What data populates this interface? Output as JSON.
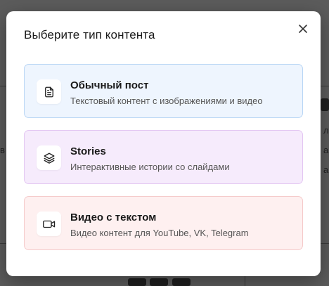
{
  "dialog": {
    "title": "Выберите тип контента",
    "close_icon": "close-icon"
  },
  "options": [
    {
      "title": "Обычный пост",
      "description": "Текстовый контент с изображениями и видео",
      "icon": "document-icon",
      "accent_bg": "#eef5fe",
      "accent_border": "#b9d6f5"
    },
    {
      "title": "Stories",
      "description": "Интерактивные истории со слайдами",
      "icon": "layers-icon",
      "accent_bg": "#f6ebfc",
      "accent_border": "#e3c6f2"
    },
    {
      "title": "Видео с текстом",
      "description": "Видео контент для YouTube, VK, Telegram",
      "icon": "video-icon",
      "accent_bg": "#fef0f0",
      "accent_border": "#f5caca"
    }
  ],
  "background": {
    "right_edge_letters": [
      "л",
      "а",
      "а"
    ],
    "left_edge_letter": "в"
  }
}
